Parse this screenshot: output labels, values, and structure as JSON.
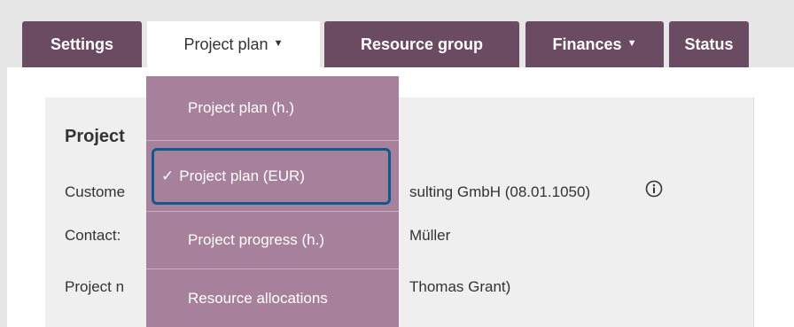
{
  "tabs": [
    {
      "label": "Settings"
    },
    {
      "label": "Project plan",
      "caret": "▼"
    },
    {
      "label": "Resource group"
    },
    {
      "label": "Finances",
      "caret": "▼"
    },
    {
      "label": "Status"
    }
  ],
  "dropdown": {
    "items": [
      {
        "label": "Project plan (h.)"
      },
      {
        "label": "Project plan (EUR)",
        "check": "✓"
      },
      {
        "label": "Project progress (h.)"
      },
      {
        "label": "Resource allocations"
      }
    ]
  },
  "project_section": {
    "title_visible": "Project",
    "rows": [
      {
        "label": "Custome",
        "value": "sulting GmbH (08.01.1050)"
      },
      {
        "label": "Contact:",
        "value": "Müller"
      },
      {
        "label": "Project n",
        "value": "Thomas Grant)"
      }
    ]
  },
  "colors": {
    "tab_bg": "#6b4b62",
    "dropdown_bg": "#a7819c",
    "selected_outline": "#0e5a8a"
  }
}
